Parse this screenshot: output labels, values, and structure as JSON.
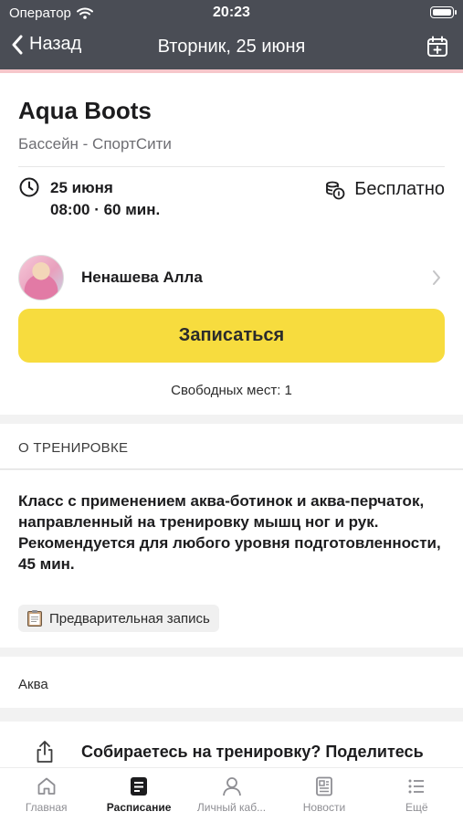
{
  "status_bar": {
    "carrier": "Оператор",
    "time": "20:23"
  },
  "nav": {
    "back_label": "Назад",
    "title": "Вторник, 25 июня"
  },
  "class": {
    "title": "Aqua Boots",
    "subtitle": "Бассейн - СпортСити",
    "date": "25 июня",
    "time": "08:00 · 60 мин.",
    "price": "Бесплатно"
  },
  "trainer": {
    "name": "Ненашева Алла"
  },
  "signup": {
    "button_label": "Записаться",
    "free_spots": "Свободных мест: 1"
  },
  "about": {
    "section_title": "О ТРЕНИРОВКЕ",
    "description": "Класс с применением аква-ботинок и аква-перчаток, направленный на тренировку мышц ног и рук. Рекомендуется для любого уровня подготовленности, 45 мин.",
    "tag_label": "Предварительная запись"
  },
  "category": {
    "label": "Аква"
  },
  "share": {
    "text": "Собираетесь на тренировку? Поделитесь с друзьями!"
  },
  "tabbar": {
    "items": [
      {
        "label": "Главная",
        "icon": "home-icon"
      },
      {
        "label": "Расписание",
        "icon": "schedule-icon",
        "active": true
      },
      {
        "label": "Личный каб...",
        "icon": "profile-icon"
      },
      {
        "label": "Новости",
        "icon": "news-icon"
      },
      {
        "label": "Ещё",
        "icon": "more-icon"
      }
    ]
  },
  "colors": {
    "header_bg": "#4a4d55",
    "accent_yellow": "#f7dc3e",
    "header_pink_line": "#f6c7cb"
  }
}
